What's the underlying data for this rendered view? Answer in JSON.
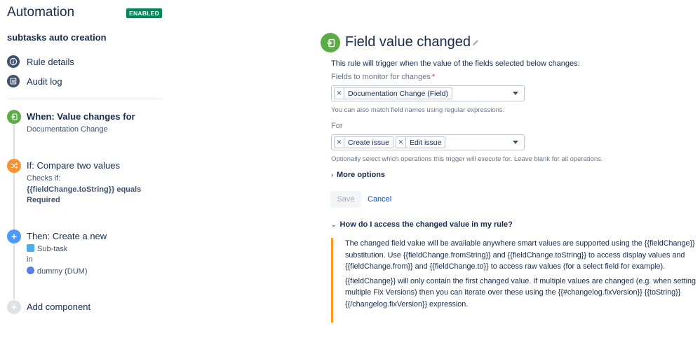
{
  "app": {
    "title": "Automation",
    "status_badge": "ENABLED"
  },
  "rule": {
    "name": "subtasks auto creation"
  },
  "nav": [
    {
      "label": "Rule details",
      "icon": "info-icon"
    },
    {
      "label": "Audit log",
      "icon": "list-icon"
    }
  ],
  "components": {
    "trigger": {
      "title": "When: Value changes for",
      "detail": "Documentation Change",
      "icon": "field-change-icon",
      "color": "#5aac44"
    },
    "condition": {
      "title": "If: Compare two values",
      "line1": "Checks if:",
      "line2": "{{fieldChange.toString}} equals",
      "line3": "Required",
      "icon": "shuffle-icon",
      "color": "#f79232"
    },
    "action": {
      "title": "Then: Create a new",
      "issue_type": "Sub-task",
      "in_label": "in",
      "project": "dummy (DUM)",
      "icon": "plus-icon",
      "color": "#4c9aff"
    },
    "add": {
      "title": "Add component",
      "icon": "plus-icon",
      "color": "#dfe1e6"
    }
  },
  "panel": {
    "title": "Field value changed",
    "description": "This rule will trigger when the value of the fields selected below changes:",
    "fields_label": "Fields to monitor for changes",
    "required_mark": "*",
    "fields_selected": [
      "Documentation Change (Field)"
    ],
    "fields_helper": "You can also match field names using regular expressions.",
    "for_label": "For",
    "operations_selected": [
      "Create issue",
      "Edit issue"
    ],
    "operations_helper": "Optionally select which operations this trigger will execute for. Leave blank for all operations.",
    "more_options": "More options",
    "save": "Save",
    "cancel": "Cancel",
    "howto_title": "How do I access the changed value in my rule?",
    "howto_p1": "The changed field value will be available anywhere smart values are supported using the {{fieldChange}} substitution. Use {{fieldChange.fromString}} and {{fieldChange.toString}} to access display values and {{fieldChange.from}} and {{fieldChange.to}} to access raw values (for a select field for example).",
    "howto_p2": "{{fieldChange}} will only contain the first changed value. If multiple values are changed (e.g. when setting multiple Fix Versions) then you can iterate over these using the {{#changelog.fixVersion}} {{toString}}{{/changelog.fixVersion}} expression."
  },
  "colors": {
    "enabled_badge": "#00875a",
    "accent_link": "#0052cc",
    "info_bar": "#ff991f",
    "required": "#de350b"
  }
}
